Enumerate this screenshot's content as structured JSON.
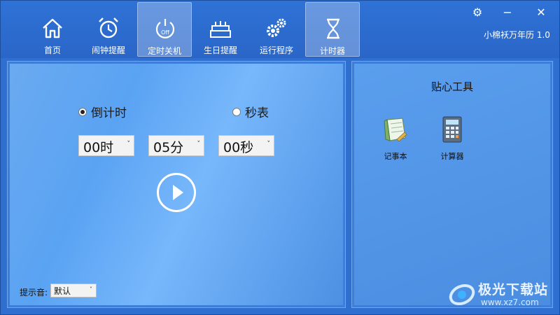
{
  "app": {
    "title": "小棉袄万年历 1.0"
  },
  "tabs": [
    {
      "label": "首页",
      "icon": "home-icon"
    },
    {
      "label": "闹钟提醒",
      "icon": "alarm-clock-icon"
    },
    {
      "label": "定时关机",
      "icon": "power-off-icon"
    },
    {
      "label": "生日提醒",
      "icon": "birthday-cake-icon"
    },
    {
      "label": "运行程序",
      "icon": "gears-icon"
    },
    {
      "label": "计时器",
      "icon": "hourglass-icon"
    }
  ],
  "active_tab": "计时器",
  "window_controls": {
    "settings": "⚙",
    "minimize": "−",
    "close": "✕"
  },
  "timer": {
    "mode_countdown": "倒计时",
    "mode_stopwatch": "秒表",
    "selected_mode": "倒计时",
    "hours": "00时",
    "minutes": "05分",
    "seconds": "00秒",
    "dropdown_chevron": "˅"
  },
  "sound": {
    "label": "提示音:",
    "value": "默认"
  },
  "tools": {
    "title": "贴心工具",
    "items": [
      {
        "label": "记事本",
        "icon": "notepad-icon"
      },
      {
        "label": "计算器",
        "icon": "calculator-icon"
      }
    ]
  },
  "watermark": {
    "text": "极光下载站",
    "url": "www.xz7.com"
  },
  "colors": {
    "toolbar": "#2f72d6",
    "panel": "#5aa3f3",
    "accent": "#ffffff"
  }
}
